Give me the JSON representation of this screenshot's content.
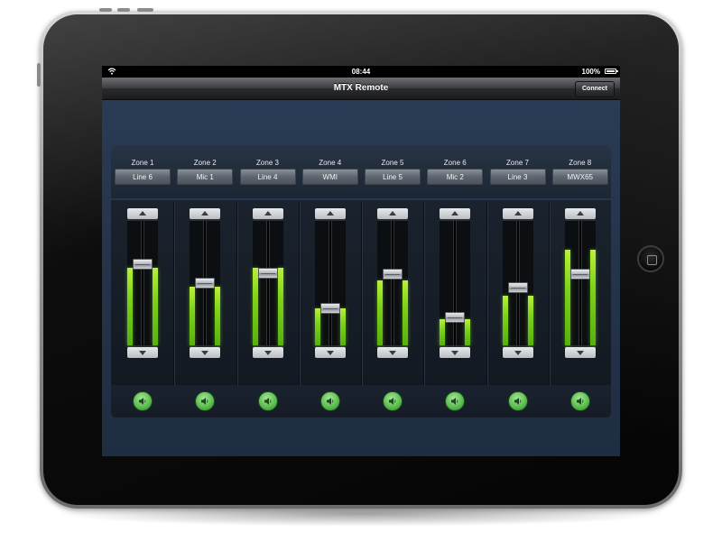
{
  "status_bar": {
    "time": "08:44",
    "battery": "100%"
  },
  "nav_bar": {
    "title": "MTX Remote",
    "connect_label": "Connect"
  },
  "colors": {
    "meter_green": "#7ed21a",
    "mute_green": "#5dbf52",
    "panel_bg": "#1e2b3e"
  },
  "zones": [
    {
      "label": "Zone 1",
      "source": "Line 6",
      "fader_level": 0.67,
      "meter_level": 0.62
    },
    {
      "label": "Zone 2",
      "source": "Mic 1",
      "fader_level": 0.5,
      "meter_level": 0.47
    },
    {
      "label": "Zone 3",
      "source": "Line 4",
      "fader_level": 0.59,
      "meter_level": 0.62
    },
    {
      "label": "Zone 4",
      "source": "WMI",
      "fader_level": 0.28,
      "meter_level": 0.3
    },
    {
      "label": "Zone 5",
      "source": "Line 5",
      "fader_level": 0.58,
      "meter_level": 0.52
    },
    {
      "label": "Zone 6",
      "source": "Mic 2",
      "fader_level": 0.2,
      "meter_level": 0.21
    },
    {
      "label": "Zone 7",
      "source": "Line 3",
      "fader_level": 0.46,
      "meter_level": 0.4
    },
    {
      "label": "Zone 8",
      "source": "MWX65",
      "fader_level": 0.58,
      "meter_level": 0.77
    }
  ]
}
